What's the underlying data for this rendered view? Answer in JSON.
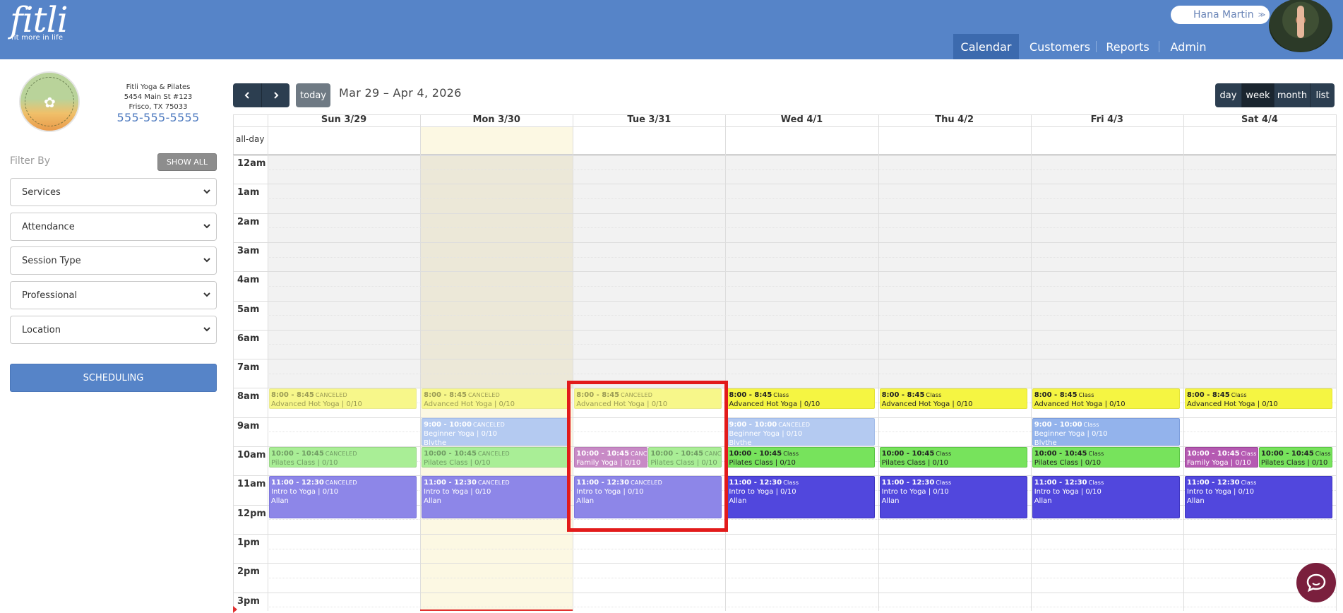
{
  "brand": {
    "logo_word": "fitli",
    "tagline": "fit more in life"
  },
  "user": {
    "name": "Hana Martin"
  },
  "nav": [
    {
      "label": "Calendar",
      "active": true
    },
    {
      "label": "Customers",
      "active": false
    },
    {
      "label": "Reports",
      "active": false
    },
    {
      "label": "Admin",
      "active": false
    }
  ],
  "studio": {
    "name": "Fitli Yoga & Pilates",
    "address1": "5454 Main St #123",
    "address2": "Frisco, TX 75033",
    "phone": "555-555-5555",
    "logo_text": "FITLI YOGA & PILATES"
  },
  "filters": {
    "label": "Filter By",
    "show_all": "SHOW ALL",
    "selects": [
      "Services",
      "Attendance",
      "Session Type",
      "Professional",
      "Location"
    ],
    "scheduling_button": "SCHEDULING"
  },
  "toolbar": {
    "prev_icon": "chevron-left",
    "next_icon": "chevron-right",
    "today": "today",
    "range": "Mar 29 – Apr 4, 2026",
    "views": [
      {
        "label": "day",
        "active": false
      },
      {
        "label": "week",
        "active": true
      },
      {
        "label": "month",
        "active": false
      },
      {
        "label": "list",
        "active": false
      }
    ]
  },
  "calendar": {
    "all_day_label": "all-day",
    "days": [
      "Sun 3/29",
      "Mon 3/30",
      "Tue 3/31",
      "Wed 4/1",
      "Thu 4/2",
      "Fri 4/3",
      "Sat 4/4"
    ],
    "today_index": 1,
    "hours": [
      "12am",
      "1am",
      "2am",
      "3am",
      "4am",
      "5am",
      "6am",
      "7am",
      "8am",
      "9am",
      "10am",
      "11am",
      "12pm",
      "1pm",
      "2pm",
      "3pm"
    ],
    "events": [
      {
        "day": 0,
        "start": 8,
        "end": 8.75,
        "time": "8:00 - 8:45",
        "status": "CANCELED",
        "title": "Advanced Hot Yoga | 0/10",
        "who": "",
        "color": "yellow",
        "canceled": true,
        "col": 0,
        "cols": 1
      },
      {
        "day": 1,
        "start": 8,
        "end": 8.75,
        "time": "8:00 - 8:45",
        "status": "CANCELED",
        "title": "Advanced Hot Yoga | 0/10",
        "who": "",
        "color": "yellow",
        "canceled": true,
        "col": 0,
        "cols": 1
      },
      {
        "day": 2,
        "start": 8,
        "end": 8.75,
        "time": "8:00 - 8:45",
        "status": "CANCELED",
        "title": "Advanced Hot Yoga | 0/10",
        "who": "",
        "color": "yellow",
        "canceled": true,
        "col": 0,
        "cols": 1
      },
      {
        "day": 3,
        "start": 8,
        "end": 8.75,
        "time": "8:00 - 8:45",
        "status": "Class",
        "title": "Advanced Hot Yoga | 0/10",
        "who": "",
        "color": "yellow",
        "canceled": false,
        "col": 0,
        "cols": 1
      },
      {
        "day": 4,
        "start": 8,
        "end": 8.75,
        "time": "8:00 - 8:45",
        "status": "Class",
        "title": "Advanced Hot Yoga | 0/10",
        "who": "",
        "color": "yellow",
        "canceled": false,
        "col": 0,
        "cols": 1
      },
      {
        "day": 5,
        "start": 8,
        "end": 8.75,
        "time": "8:00 - 8:45",
        "status": "Class",
        "title": "Advanced Hot Yoga | 0/10",
        "who": "",
        "color": "yellow",
        "canceled": false,
        "col": 0,
        "cols": 1
      },
      {
        "day": 6,
        "start": 8,
        "end": 8.75,
        "time": "8:00 - 8:45",
        "status": "Class",
        "title": "Advanced Hot Yoga | 0/10",
        "who": "",
        "color": "yellow",
        "canceled": false,
        "col": 0,
        "cols": 1
      },
      {
        "day": 1,
        "start": 9,
        "end": 10,
        "time": "9:00 - 10:00",
        "status": "CANCELED",
        "title": "Beginner Yoga | 0/10",
        "who": "Blythe",
        "color": "blue",
        "canceled": true,
        "col": 0,
        "cols": 1
      },
      {
        "day": 3,
        "start": 9,
        "end": 10,
        "time": "9:00 - 10:00",
        "status": "CANCELED",
        "title": "Beginner Yoga | 0/10",
        "who": "Blythe",
        "color": "blue",
        "canceled": true,
        "col": 0,
        "cols": 1
      },
      {
        "day": 5,
        "start": 9,
        "end": 10,
        "time": "9:00 - 10:00",
        "status": "Class",
        "title": "Beginner Yoga | 0/10",
        "who": "Blythe",
        "color": "blue",
        "canceled": false,
        "col": 0,
        "cols": 1
      },
      {
        "day": 0,
        "start": 10,
        "end": 10.75,
        "time": "10:00 - 10:45",
        "status": "CANCELED",
        "title": "Pilates Class | 0/10",
        "who": "",
        "color": "green",
        "canceled": true,
        "col": 0,
        "cols": 1
      },
      {
        "day": 1,
        "start": 10,
        "end": 10.75,
        "time": "10:00 - 10:45",
        "status": "CANCELED",
        "title": "Pilates Class | 0/10",
        "who": "",
        "color": "green",
        "canceled": true,
        "col": 0,
        "cols": 1
      },
      {
        "day": 2,
        "start": 10,
        "end": 10.75,
        "time": "10:00 - 10:45",
        "status": "CANCELED",
        "title": "Family Yoga | 0/10",
        "who": "",
        "color": "mauve",
        "canceled": true,
        "col": 0,
        "cols": 2
      },
      {
        "day": 2,
        "start": 10,
        "end": 10.75,
        "time": "10:00 - 10:45",
        "status": "CANCELED",
        "title": "Pilates Class | 0/10",
        "who": "",
        "color": "green",
        "canceled": true,
        "col": 1,
        "cols": 2
      },
      {
        "day": 3,
        "start": 10,
        "end": 10.75,
        "time": "10:00 - 10:45",
        "status": "Class",
        "title": "Pilates Class | 0/10",
        "who": "",
        "color": "green",
        "canceled": false,
        "col": 0,
        "cols": 1
      },
      {
        "day": 4,
        "start": 10,
        "end": 10.75,
        "time": "10:00 - 10:45",
        "status": "Class",
        "title": "Pilates Class | 0/10",
        "who": "",
        "color": "green",
        "canceled": false,
        "col": 0,
        "cols": 1
      },
      {
        "day": 5,
        "start": 10,
        "end": 10.75,
        "time": "10:00 - 10:45",
        "status": "Class",
        "title": "Pilates Class | 0/10",
        "who": "",
        "color": "green",
        "canceled": false,
        "col": 0,
        "cols": 1
      },
      {
        "day": 6,
        "start": 10,
        "end": 10.75,
        "time": "10:00 - 10:45",
        "status": "Class",
        "title": "Family Yoga | 0/10",
        "who": "",
        "color": "mauve",
        "canceled": false,
        "col": 0,
        "cols": 2
      },
      {
        "day": 6,
        "start": 10,
        "end": 10.75,
        "time": "10:00 - 10:45",
        "status": "Class",
        "title": "Pilates Class | 0/10",
        "who": "",
        "color": "green",
        "canceled": false,
        "col": 1,
        "cols": 2
      },
      {
        "day": 0,
        "start": 11,
        "end": 12.5,
        "time": "11:00 - 12:30",
        "status": "CANCELED",
        "title": "Intro to Yoga | 0/10",
        "who": "Allan",
        "color": "purple",
        "canceled": true,
        "col": 0,
        "cols": 1
      },
      {
        "day": 1,
        "start": 11,
        "end": 12.5,
        "time": "11:00 - 12:30",
        "status": "CANCELED",
        "title": "Intro to Yoga | 0/10",
        "who": "Allan",
        "color": "purple",
        "canceled": true,
        "col": 0,
        "cols": 1
      },
      {
        "day": 2,
        "start": 11,
        "end": 12.5,
        "time": "11:00 - 12:30",
        "status": "CANCELED",
        "title": "Intro to Yoga | 0/10",
        "who": "Allan",
        "color": "purple",
        "canceled": true,
        "col": 0,
        "cols": 1
      },
      {
        "day": 3,
        "start": 11,
        "end": 12.5,
        "time": "11:00 - 12:30",
        "status": "Class",
        "title": "Intro to Yoga | 0/10",
        "who": "Allan",
        "color": "purple",
        "canceled": false,
        "col": 0,
        "cols": 1
      },
      {
        "day": 4,
        "start": 11,
        "end": 12.5,
        "time": "11:00 - 12:30",
        "status": "Class",
        "title": "Intro to Yoga | 0/10",
        "who": "Allan",
        "color": "purple",
        "canceled": false,
        "col": 0,
        "cols": 1
      },
      {
        "day": 5,
        "start": 11,
        "end": 12.5,
        "time": "11:00 - 12:30",
        "status": "Class",
        "title": "Intro to Yoga | 0/10",
        "who": "Allan",
        "color": "purple",
        "canceled": false,
        "col": 0,
        "cols": 1
      },
      {
        "day": 6,
        "start": 11,
        "end": 12.5,
        "time": "11:00 - 12:30",
        "status": "Class",
        "title": "Intro to Yoga | 0/10",
        "who": "Allan",
        "color": "purple",
        "canceled": false,
        "col": 0,
        "cols": 1
      }
    ]
  },
  "colors": {
    "header": "#5684c8",
    "toolbar_button": "#2c3e50",
    "highlight": "#e21b1b",
    "chat_button": "#7a1f3d"
  }
}
